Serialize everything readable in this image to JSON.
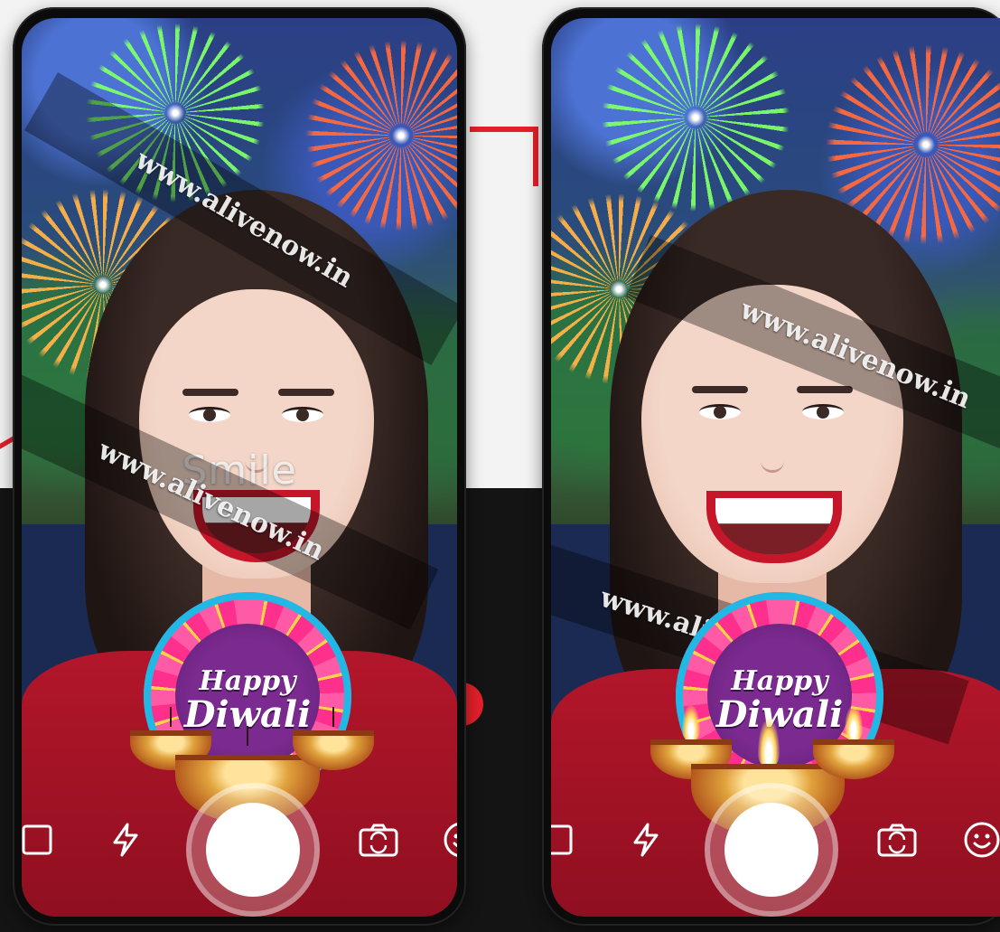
{
  "phones": [
    {
      "watermark_text": "www.alivenow.in",
      "overlay_text": "Smile",
      "badge": {
        "line1": "Happy",
        "line2": "Diwali"
      },
      "controls": {
        "gallery_icon": "gallery-icon",
        "flash_icon": "flash-icon",
        "shutter": "shutter-button",
        "flip_camera_icon": "flip-camera-icon",
        "emoji_icon": "emoji-icon"
      }
    },
    {
      "watermark_text": "www.alivenow.in",
      "overlay_text": "",
      "badge": {
        "line1": "Happy",
        "line2": "Diwali"
      },
      "controls": {
        "gallery_icon": "gallery-icon",
        "flash_icon": "flash-icon",
        "shutter": "shutter-button",
        "flip_camera_icon": "flip-camera-icon",
        "emoji_icon": "emoji-icon"
      }
    }
  ],
  "colors": {
    "background_top": "#f3f3f3",
    "background_bottom": "#141414",
    "accent_red": "#e3202a",
    "shirt_red": "#b3162a",
    "badge_pink": "#ff2f8e",
    "badge_purple": "#7b2a8f",
    "badge_blue": "#21b8e6",
    "diya_gold": "#e0a23c"
  }
}
